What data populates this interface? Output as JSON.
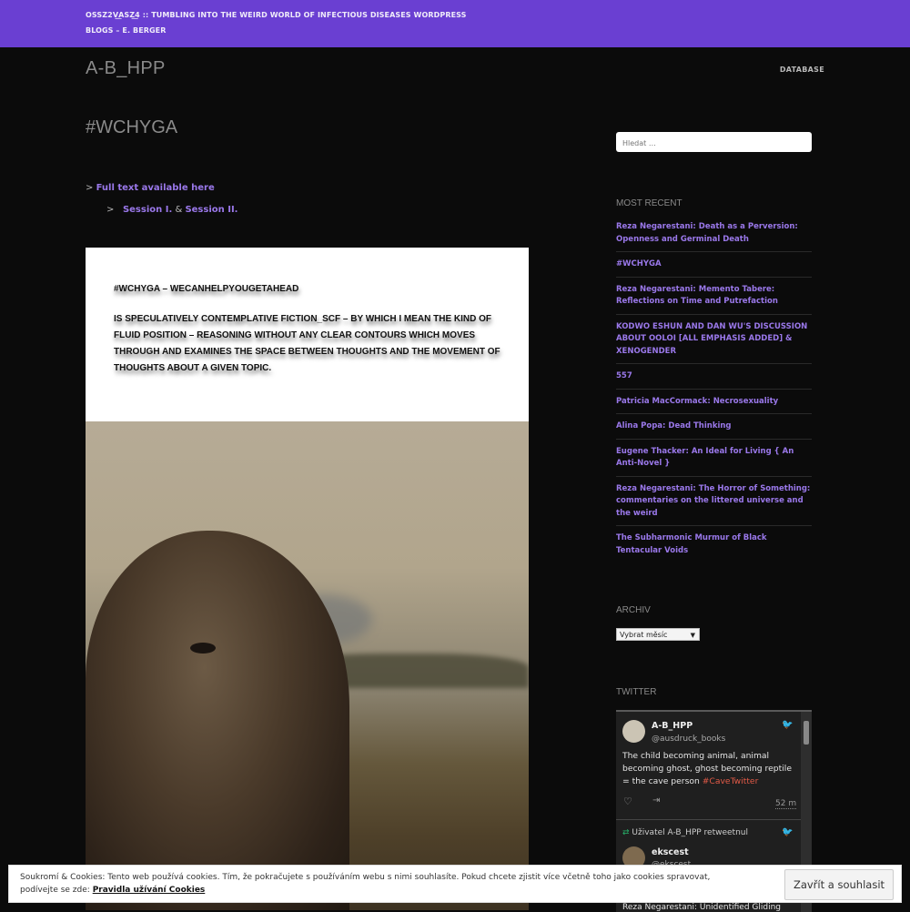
{
  "topbar": {
    "ticker": "OSSZ2V͟ASZ͟4 :: TUMBLING INTO THE WEIRD WORLD OF INFECTIOUS DISEASES WORDPRESS BLOGS – E. BERGER"
  },
  "site": {
    "title": "A-B_HPP",
    "nav_item": "DATABASE"
  },
  "post": {
    "title": "#WCHYGA",
    "prefix1": ">",
    "link_fulltext": "Full text available here",
    "prefix2": ">",
    "link_session1": "Session I.",
    "amp": "&",
    "link_session2": "Session II.",
    "image_header": "#WCHYGA – WECANHELPYOUGETAHEAD",
    "image_body": "IS SPECULATIVELY CONTEMPLATIVE FICTION_SCF – BY WHICH I MEAN THE KIND OF FLUID POSITION – REASONING WITHOUT ANY CLEAR CONTOURS WHICH MOVES THROUGH AND EXAMINES THE SPACE BETWEEN THOUGHTS AND THE MOVEMENT OF THOUGHTS ABOUT A GIVEN TOPIC."
  },
  "sidebar": {
    "search_placeholder": "Hledat …",
    "recent_heading": "MOST RECENT",
    "recent": [
      "Reza Negarestani: Death as a Perversion: Openness and Germinal Death",
      "#WCHYGA",
      "Reza Negarestani: Memento Tabere: Reflections on Time and Putrefaction",
      "KODWO ESHUN AND DAN WU'S DISCUSSION ABOUT OOLOI [ALL EMPHASIS ADDED] & XENOGENDER",
      "557",
      "Patricia MacCormack: Necrosexuality",
      "Alina Popa: Dead Thinking",
      "Eugene Thacker: An Ideal for Living { An Anti-Novel }",
      "Reza Negarestani: The Horror of Something: commentaries on the littered universe and the weird",
      "The Subharmonic Murmur of Black Tentacular Voids"
    ],
    "archive_heading": "ARCHIV",
    "archive_select": "Vybrat měsíc",
    "twitter_heading": "TWITTER"
  },
  "twitter": {
    "tweet1": {
      "name": "A-B_HPP",
      "handle": "@ausdruck_books",
      "text": "The child becoming animal, animal becoming ghost, ghost becoming reptile = the cave person ",
      "hashtag": "#CaveTwitter",
      "time": "52 m"
    },
    "retweet_label": "Uživatel A-B_HPP retweetnul",
    "tweet2": {
      "name": "ekscest",
      "handle": "@ekscest",
      "text": "Reza Negarestani: Unidentified Gliding"
    }
  },
  "cookie": {
    "message": "Soukromí & Cookies: Tento web používá cookies. Tím, že pokračujete s používáním webu s nimi souhlasíte. Pokud chcete zjistit více včetně toho jako cookies spravovat, podívejte se zde: ",
    "link": "Pravidla užívání Cookies",
    "button": "Zavřít a souhlasit"
  }
}
